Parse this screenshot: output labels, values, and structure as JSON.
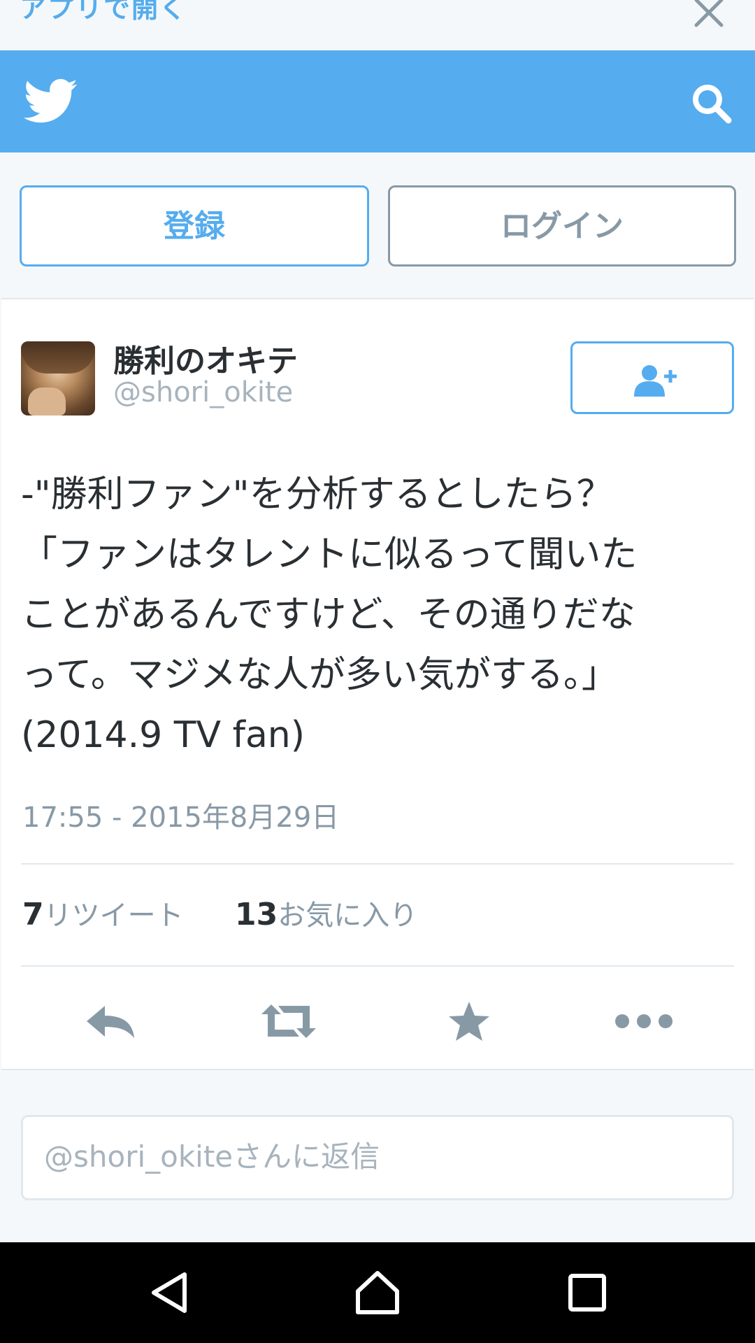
{
  "banner": {
    "open_app_label": "アプリで開く"
  },
  "auth": {
    "signup_label": "登録",
    "login_label": "ログイン"
  },
  "tweet": {
    "display_name": "勝利のオキテ",
    "handle": "@shori_okite",
    "text": "-\"勝利ファン\"を分析するとしたら？\n「ファンはタレントに似るって聞いた\nことがあるんですけど、その通りだな\nって。マジメな人が多い気がする。」\n(2014.9 TV fan)",
    "timestamp": "17:55 - 2015年8月29日",
    "retweets": {
      "count": "7",
      "label": "リツイート"
    },
    "favorites": {
      "count": "13",
      "label": "お気に入り"
    }
  },
  "reply": {
    "placeholder": "@shori_okiteさんに返信"
  },
  "icons": [
    "close-icon",
    "twitter-bird-icon",
    "search-icon",
    "follow-icon",
    "reply-icon",
    "retweet-icon",
    "favorite-star-icon",
    "more-icon",
    "nav-back-icon",
    "nav-home-icon",
    "nav-recents-icon"
  ],
  "colors": {
    "brand": "#55acee",
    "text": "#292f33",
    "muted": "#8899a6"
  }
}
